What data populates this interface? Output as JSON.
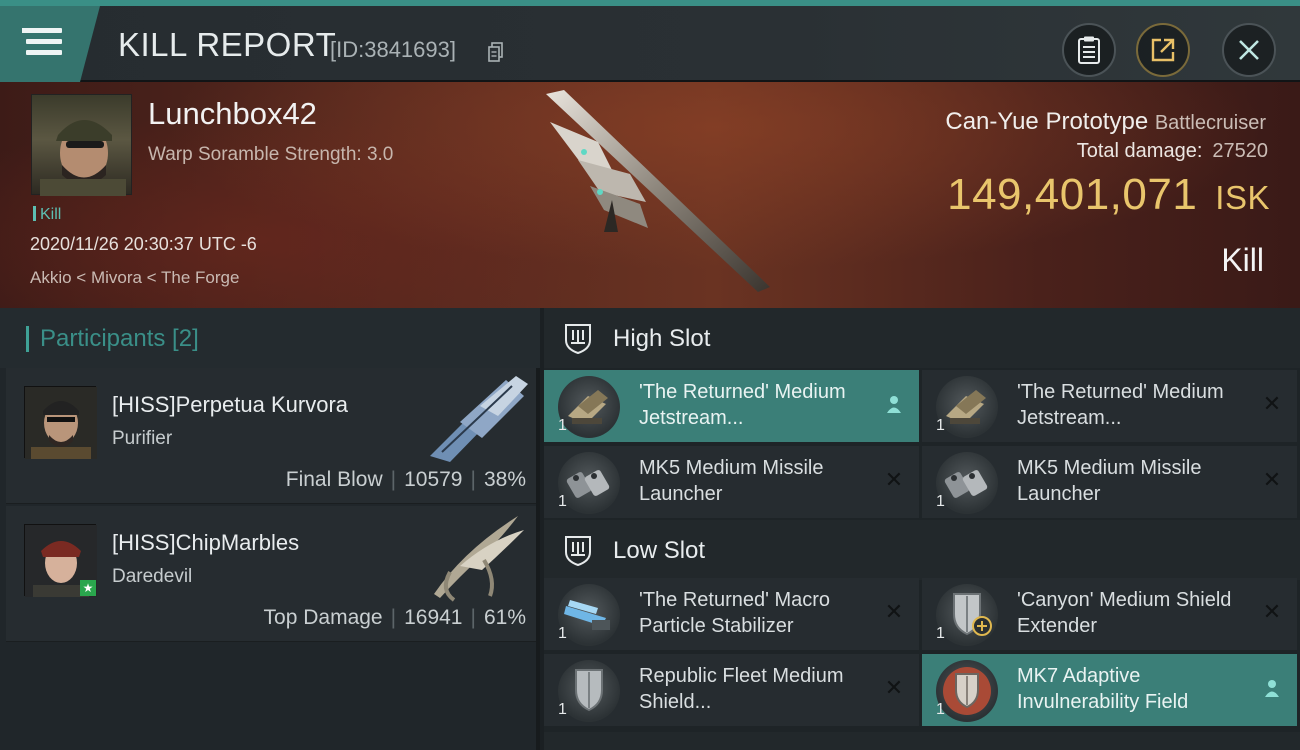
{
  "header": {
    "title": "KILL REPORT",
    "report_id": "[ID:3841693]"
  },
  "victim": {
    "name": "Lunchbox42",
    "warp_scramble": "Warp Soramble Strength: 3.0",
    "kill_tag": "Kill",
    "datetime": "2020/11/26 20:30:37 UTC -6",
    "location": "Akkio < Mivora < The Forge",
    "ship_name": "Can-Yue Prototype",
    "ship_class": "Battlecruiser",
    "total_damage_label": "Total damage:",
    "total_damage_value": "27520",
    "isk_value": "149,401,071",
    "isk_unit": "ISK",
    "result": "Kill"
  },
  "participants": {
    "title": "Participants [2]",
    "items": [
      {
        "name": "[HISS]Perpetua Kurvora",
        "ship": "Purifier",
        "role": "Final Blow",
        "damage": "10579",
        "percent": "38%"
      },
      {
        "name": "[HISS]ChipMarbles",
        "ship": "Daredevil",
        "role": "Top Damage",
        "damage": "16941",
        "percent": "61%"
      }
    ]
  },
  "fitting": {
    "high_slot_label": "High Slot",
    "low_slot_label": "Low Slot",
    "high": [
      {
        "name": "'The Returned' Medium Jetstream...",
        "qty": "1",
        "status": "pilot"
      },
      {
        "name": "'The Returned' Medium Jetstream...",
        "qty": "1",
        "status": "destroyed"
      },
      {
        "name": "MK5 Medium Missile Launcher",
        "qty": "1",
        "status": "destroyed"
      },
      {
        "name": "MK5 Medium Missile Launcher",
        "qty": "1",
        "status": "destroyed"
      }
    ],
    "low": [
      {
        "name": "'The Returned' Macro Particle Stabilizer",
        "qty": "1",
        "status": "destroyed"
      },
      {
        "name": "'Canyon' Medium Shield Extender",
        "qty": "1",
        "status": "destroyed"
      },
      {
        "name": "Republic Fleet Medium Shield...",
        "qty": "1",
        "status": "destroyed"
      },
      {
        "name": "MK7 Adaptive Invulnerability Field",
        "qty": "1",
        "status": "pilot"
      }
    ]
  },
  "colors": {
    "accent_teal": "#3b7f78",
    "isk_gold": "#e9c56c",
    "hero_red": "#5a2a1f"
  }
}
